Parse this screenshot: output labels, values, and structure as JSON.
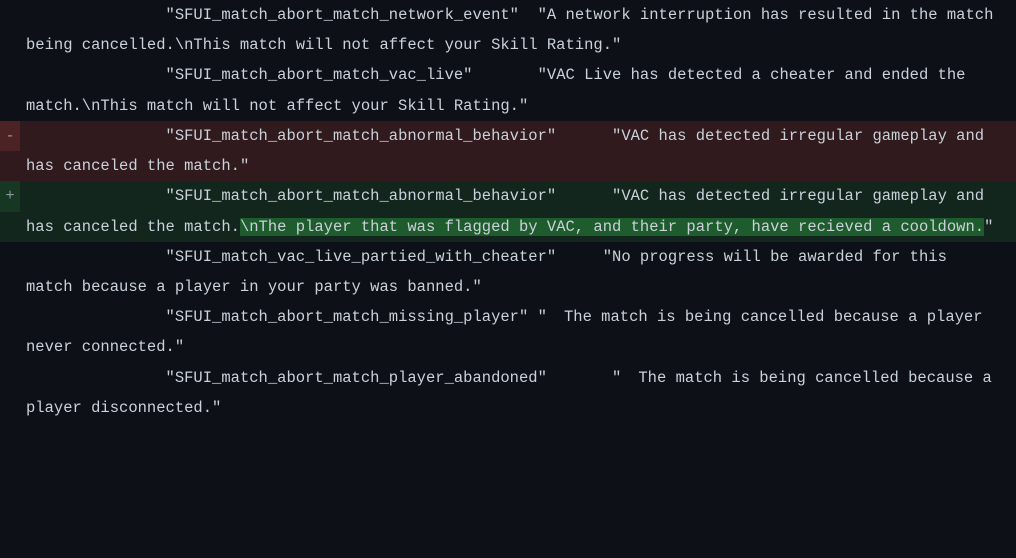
{
  "diff": {
    "lines": [
      {
        "type": "context",
        "marker": " ",
        "indent": "               ",
        "key": "\"SFUI_match_abort_match_network_event\"",
        "spacer": "  ",
        "value": "\"A network interruption has resulted in the match being cancelled.\\nThis match will not affect your Skill Rating.\""
      },
      {
        "type": "context",
        "marker": " ",
        "indent": "               ",
        "key": "\"SFUI_match_abort_match_vac_live\"",
        "spacer": "       ",
        "value": "\"VAC Live has detected a cheater and ended the match.\\nThis match will not affect your Skill Rating.\""
      },
      {
        "type": "deletion",
        "marker": "-",
        "indent": "               ",
        "key": "\"SFUI_match_abort_match_abnormal_behavior\"",
        "spacer": "      ",
        "value_before": "\"VAC has detected irregular gameplay and has canceled the match.",
        "highlight": "",
        "value_after": "\""
      },
      {
        "type": "addition",
        "marker": "+",
        "indent": "               ",
        "key": "\"SFUI_match_abort_match_abnormal_behavior\"",
        "spacer": "      ",
        "value_before": "\"VAC has detected irregular gameplay and has canceled the match.",
        "highlight": "\\nThe player that was flagged by VAC, and their party, have recieved a cooldown.",
        "value_after": "\""
      },
      {
        "type": "context",
        "marker": " ",
        "indent": "               ",
        "key": "\"SFUI_match_vac_live_partied_with_cheater\"",
        "spacer": "     ",
        "value": "\"No progress will be awarded for this match because a player in your party was banned.\""
      },
      {
        "type": "context",
        "marker": " ",
        "indent": "               ",
        "key": "\"SFUI_match_abort_match_missing_player\"",
        "spacer": " ",
        "value": "\"  The match is being cancelled because a player never connected.\""
      },
      {
        "type": "context",
        "marker": " ",
        "indent": "               ",
        "key": "\"SFUI_match_abort_match_player_abandoned\"",
        "spacer": "       ",
        "value": "\"  The match is being cancelled because a player disconnected.\""
      }
    ]
  }
}
